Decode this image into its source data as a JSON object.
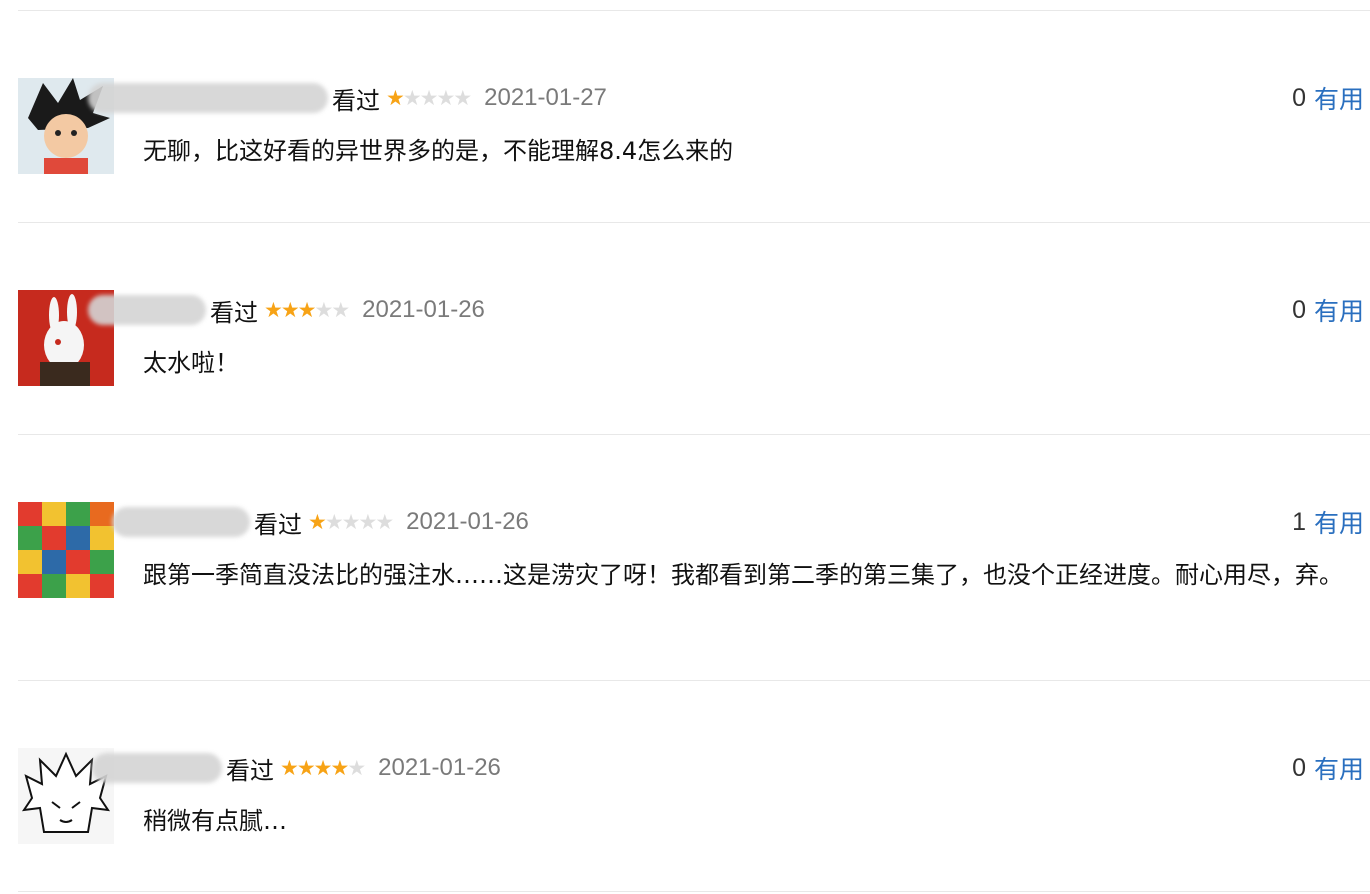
{
  "comments": [
    {
      "status": "看过",
      "rating": 1,
      "rating_max": 5,
      "date": "2021-01-27",
      "votes": "0",
      "useful_label": "有用",
      "text": "无聊，比这好看的异世界多的是，不能理解8.4怎么来的"
    },
    {
      "status": "看过",
      "rating": 3,
      "rating_max": 5,
      "date": "2021-01-26",
      "votes": "0",
      "useful_label": "有用",
      "text": "太水啦！"
    },
    {
      "status": "看过",
      "rating": 1,
      "rating_max": 5,
      "date": "2021-01-26",
      "votes": "1",
      "useful_label": "有用",
      "text": "跟第一季简直没法比的强注水……这是涝灾了呀！我都看到第二季的第三集了，也没个正经进度。耐心用尽，弃。"
    },
    {
      "status": "看过",
      "rating": 4,
      "rating_max": 5,
      "date": "2021-01-26",
      "votes": "0",
      "useful_label": "有用",
      "text": "稍微有点腻…"
    }
  ],
  "colors": {
    "star_on": "#f7a316",
    "star_off": "#dddddd",
    "link": "#2a6fbf",
    "date": "#7a7a7a",
    "divider": "#e8e8e8"
  }
}
